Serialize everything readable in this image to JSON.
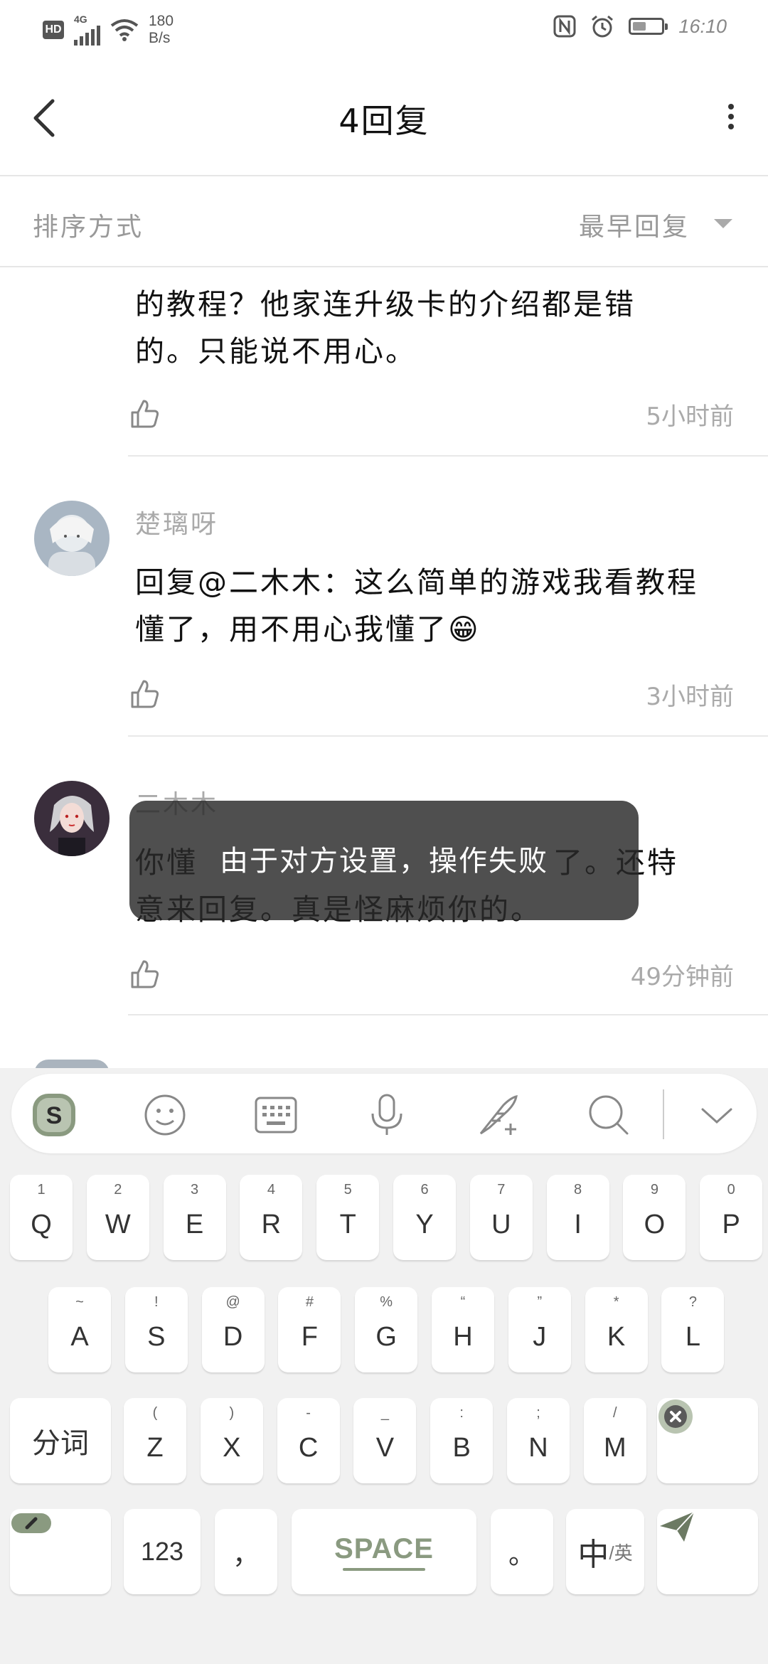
{
  "status_bar": {
    "network_badge": "HD",
    "network_type": "4G",
    "speed_value": "180",
    "speed_unit": "B/s",
    "battery_level": 0.4,
    "time": "16:10"
  },
  "header": {
    "title": "4回复"
  },
  "sort": {
    "label": "排序方式",
    "value": "最早回复"
  },
  "comments": [
    {
      "text_line1": "的教程？他家连升级卡的介绍都是错",
      "text_line2": "的。只能说不用心。",
      "time": "5小时前"
    },
    {
      "name": "楚璃呀",
      "text_line1": "回复@二木木：这么简单的游戏我看教程",
      "text_line2": "懂了，用不用心我懂了",
      "emoji": "😁",
      "time": "3小时前"
    },
    {
      "name": "二木木",
      "text_line1": "你懂",
      "text_line2": "意来回复。真是怪麻烦你的。",
      "text_end": "了。还特",
      "time": "49分钟前"
    },
    {
      "name": "…"
    }
  ],
  "toast": {
    "text": "由于对方设置，操作失败"
  },
  "keyboard": {
    "row1": [
      {
        "main": "Q",
        "sub": "1"
      },
      {
        "main": "W",
        "sub": "2"
      },
      {
        "main": "E",
        "sub": "3"
      },
      {
        "main": "R",
        "sub": "4"
      },
      {
        "main": "T",
        "sub": "5"
      },
      {
        "main": "Y",
        "sub": "6"
      },
      {
        "main": "U",
        "sub": "7"
      },
      {
        "main": "I",
        "sub": "8"
      },
      {
        "main": "O",
        "sub": "9"
      },
      {
        "main": "P",
        "sub": "0"
      }
    ],
    "row2": [
      {
        "main": "A",
        "sub": "~"
      },
      {
        "main": "S",
        "sub": "!"
      },
      {
        "main": "D",
        "sub": "@"
      },
      {
        "main": "F",
        "sub": "#"
      },
      {
        "main": "G",
        "sub": "%"
      },
      {
        "main": "H",
        "sub": "“"
      },
      {
        "main": "J",
        "sub": "”"
      },
      {
        "main": "K",
        "sub": "*"
      },
      {
        "main": "L",
        "sub": "?"
      }
    ],
    "row3": [
      {
        "main": "Z",
        "sub": "("
      },
      {
        "main": "X",
        "sub": ")"
      },
      {
        "main": "C",
        "sub": "-"
      },
      {
        "main": "V",
        "sub": "_"
      },
      {
        "main": "B",
        "sub": ":"
      },
      {
        "main": "N",
        "sub": ";"
      },
      {
        "main": "M",
        "sub": "/"
      }
    ],
    "segment_label": "分词",
    "num_label": "123",
    "comma_label": "，",
    "space_label": "SPACE",
    "period_label": "。",
    "lang_main": "中",
    "lang_sub": "/英"
  },
  "colors": {
    "accent_green": "#8a9a80",
    "toast_bg": "#333333"
  }
}
